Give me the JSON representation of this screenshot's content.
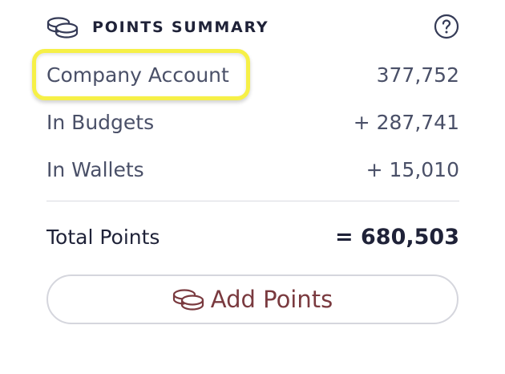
{
  "header": {
    "title": "POINTS SUMMARY",
    "icon": "coins-icon",
    "help_icon": "help-circle-icon"
  },
  "summary": {
    "rows": [
      {
        "label": "Company Account",
        "value": "377,752",
        "highlighted": true
      },
      {
        "label": "In Budgets",
        "value": "+ 287,741"
      },
      {
        "label": "In Wallets",
        "value": "+ 15,010"
      }
    ],
    "total": {
      "label": "Total Points",
      "value": "= 680,503"
    }
  },
  "actions": {
    "add_points_label": "Add Points",
    "add_points_icon": "coins-icon"
  },
  "colors": {
    "text_primary": "#1f2238",
    "text_secondary": "#4a5068",
    "highlight": "#f6f047",
    "button_text": "#7a3a3f",
    "divider": "#d9dae1"
  }
}
